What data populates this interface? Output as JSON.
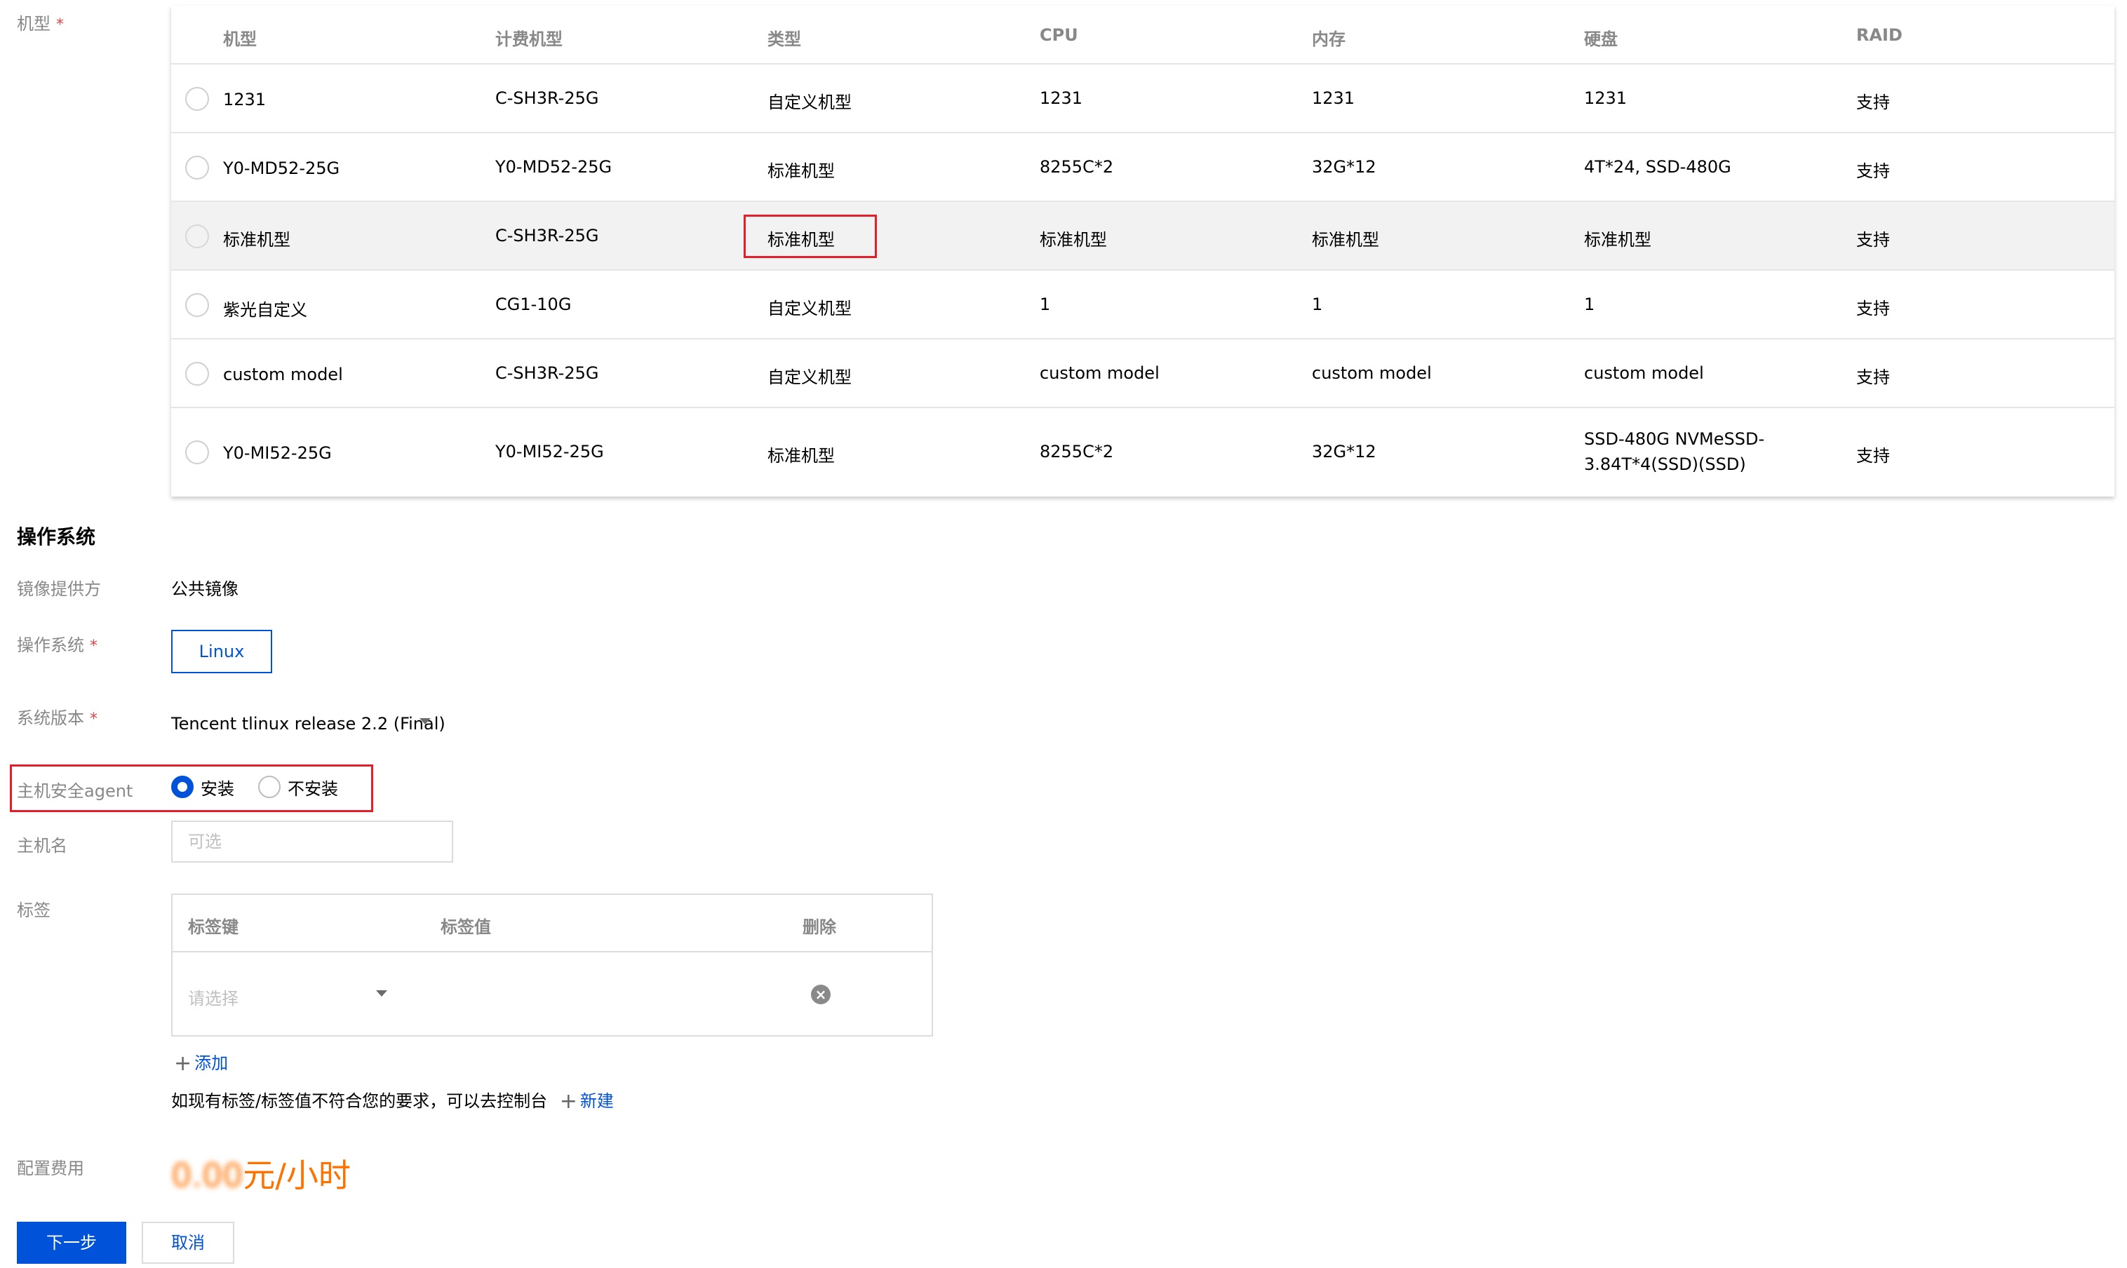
{
  "form_labels": {
    "machine_type": "机型",
    "image_provider": "镜像提供方",
    "os": "操作系统",
    "os_version": "系统版本",
    "security_agent": "主机安全agent",
    "hostname": "主机名",
    "tags": "标签",
    "cost": "配置费用"
  },
  "required_mark": "*",
  "machine_table": {
    "headers": [
      "机型",
      "计费机型",
      "类型",
      "CPU",
      "内存",
      "硬盘",
      "RAID"
    ],
    "rows": [
      {
        "name": "1231",
        "billing": "C-SH3R-25G",
        "type": "自定义机型",
        "cpu": "1231",
        "memory": "1231",
        "disk": "1231",
        "raid": "支持"
      },
      {
        "name": "Y0-MD52-25G",
        "billing": "Y0-MD52-25G",
        "type": "标准机型",
        "cpu": "8255C*2",
        "memory": "32G*12",
        "disk": "4T*24, SSD-480G",
        "raid": "支持"
      },
      {
        "name": "标准机型",
        "billing": "C-SH3R-25G",
        "type": "标准机型",
        "cpu": "标准机型",
        "memory": "标准机型",
        "disk": "标准机型",
        "raid": "支持"
      },
      {
        "name": "紫光自定义",
        "billing": "CG1-10G",
        "type": "自定义机型",
        "cpu": "1",
        "memory": "1",
        "disk": "1",
        "raid": "支持"
      },
      {
        "name": "custom model",
        "billing": "C-SH3R-25G",
        "type": "自定义机型",
        "cpu": "custom model",
        "memory": "custom model",
        "disk": "custom model",
        "raid": "支持"
      },
      {
        "name": "Y0-MI52-25G",
        "billing": "Y0-MI52-25G",
        "type": "标准机型",
        "cpu": "8255C*2",
        "memory": "32G*12",
        "disk_line1": "SSD-480G NVMeSSD-",
        "disk_line2": "3.84T*4(SSD)(SSD)",
        "raid": "支持"
      }
    ]
  },
  "os_section": {
    "title": "操作系统",
    "image_provider_value": "公共镜像",
    "os_option": "Linux",
    "os_version_value": "Tencent tlinux release 2.2 (Final)",
    "agent_options": [
      "安装",
      "不安装"
    ],
    "agent_selected": "安装",
    "hostname_placeholder": "可选"
  },
  "tags_table": {
    "headers": [
      "标签键",
      "标签值",
      "删除"
    ],
    "key_placeholder": "请选择"
  },
  "add_link": "添加",
  "tag_note": "如现有标签/标签值不符合您的要求，可以去控制台",
  "new_link": "新建",
  "price": {
    "amount_obscured": "0.00",
    "unit": "元/小时"
  },
  "buttons": {
    "next": "下一步",
    "cancel": "取消"
  },
  "colors": {
    "accent": "#0052d9",
    "price": "#ff7200",
    "highlight_box": "#e0202a",
    "required": "#e54545"
  }
}
